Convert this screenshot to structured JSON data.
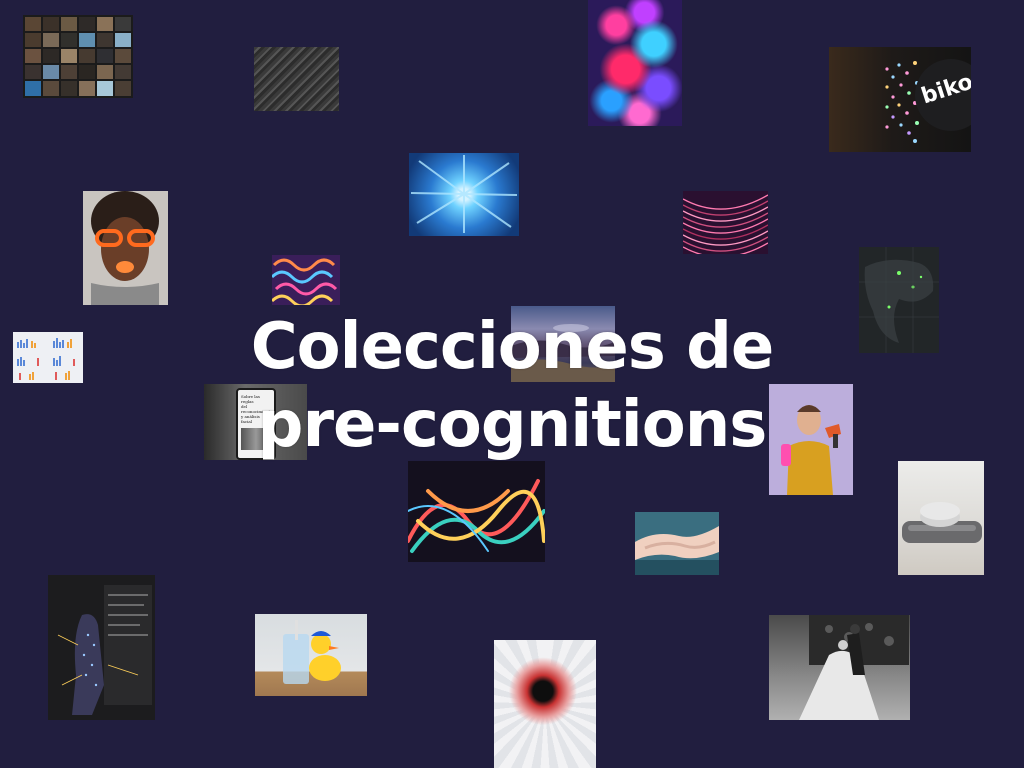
{
  "page": {
    "background": "#211e3f",
    "title_lines": [
      "Colecciones de",
      "pre-cognitions"
    ]
  },
  "thumbnails": [
    {
      "name": "conference-collage-thumb",
      "caption_lines": []
    },
    {
      "name": "diagonal-lines-texture-thumb",
      "caption_lines": []
    },
    {
      "name": "colorful-bokeh-thumb",
      "caption_lines": []
    },
    {
      "name": "biko-led-logo-thumb",
      "logo_text": "biko"
    },
    {
      "name": "blue-burst-thumb",
      "caption_lines": []
    },
    {
      "name": "woman-orange-glasses-thumb",
      "caption_lines": []
    },
    {
      "name": "pink-wave-lines-thumb",
      "caption_lines": []
    },
    {
      "name": "swirl-pattern-thumb",
      "caption_lines": []
    },
    {
      "name": "dark-world-map-thumb",
      "caption_lines": []
    },
    {
      "name": "bar-charts-grid-thumb",
      "caption_lines": []
    },
    {
      "name": "landscape-painting-thumb",
      "caption_lines": []
    },
    {
      "name": "phone-article-thumb",
      "caption_lines": [
        "Sobre las reglas",
        "del reconocimiento",
        "y análisis facial"
      ]
    },
    {
      "name": "woman-with-drill-thumb",
      "caption_lines": []
    },
    {
      "name": "smart-speaker-thumb",
      "caption_lines": []
    },
    {
      "name": "abstract-ribbons-thumb",
      "caption_lines": []
    },
    {
      "name": "hands-holding-thumb",
      "caption_lines": []
    },
    {
      "name": "projection-person-thumb",
      "caption_lines": []
    },
    {
      "name": "rubber-duck-cup-thumb",
      "caption_lines": []
    },
    {
      "name": "red-hole-texture-thumb",
      "caption_lines": []
    },
    {
      "name": "dancing-couple-bw-thumb",
      "caption_lines": []
    }
  ]
}
